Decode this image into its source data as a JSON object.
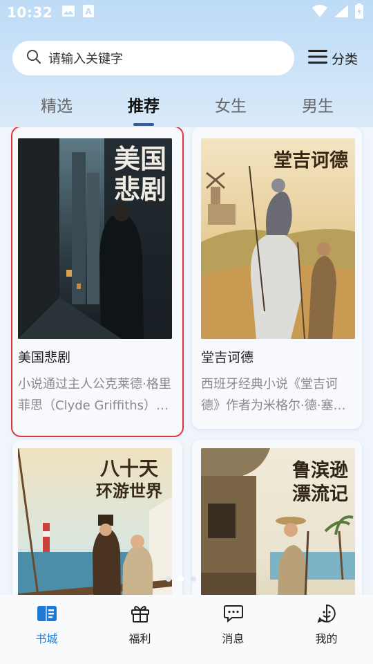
{
  "status_bar": {
    "time": "10:32",
    "icons": [
      "image-notification-icon",
      "a-notification-icon",
      "wifi-icon",
      "signal-icon",
      "battery-charging-icon"
    ]
  },
  "search": {
    "placeholder": "请输入关键字",
    "icon": "search-icon"
  },
  "category_button": {
    "label": "分类",
    "icon": "menu-icon"
  },
  "tabs": [
    {
      "label": "精选",
      "active": false
    },
    {
      "label": "推荐",
      "active": true
    },
    {
      "label": "女生",
      "active": false
    },
    {
      "label": "男生",
      "active": false
    }
  ],
  "books": [
    {
      "title": "美国悲剧",
      "cover_text": "美国悲剧",
      "description": "小说通过主人公克莱德·格里菲思（Clyde Griffiths）的一生",
      "selected": true
    },
    {
      "title": "堂吉诃德",
      "cover_text": "堂吉诃德",
      "description": "西班牙经典小说《堂吉诃德》作者为米格尔·德·塞万提斯",
      "selected": false
    },
    {
      "cover_text_line1": "八十天",
      "cover_text_line2": "环游世界"
    },
    {
      "cover_text_line1": "鲁滨逊",
      "cover_text_line2": "漂流记"
    }
  ],
  "bottom_nav": [
    {
      "label": "书城",
      "icon": "book-icon",
      "active": true
    },
    {
      "label": "福利",
      "icon": "gift-icon",
      "active": false
    },
    {
      "label": "消息",
      "icon": "message-icon",
      "active": false
    },
    {
      "label": "我的",
      "icon": "smile-icon",
      "active": false
    }
  ],
  "colors": {
    "accent": "#1e78d6",
    "selection_outline": "#e0353a",
    "tab_indicator": "#3b5a9a"
  }
}
